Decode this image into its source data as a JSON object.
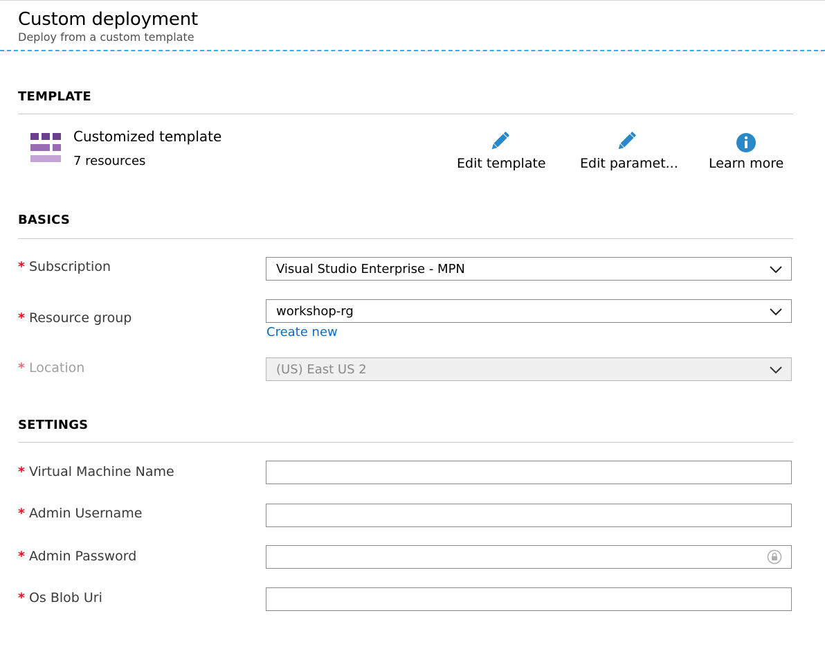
{
  "header": {
    "title": "Custom deployment",
    "subtitle": "Deploy from a custom template"
  },
  "colors": {
    "accent": "#2fb0e6",
    "link": "#0e6cc7",
    "required": "#e81123",
    "icon_blue": "#2a88c9",
    "template_purple": "#7a4a96"
  },
  "template_section": {
    "title": "TEMPLATE",
    "template_name": "Customized template",
    "resource_count": "7 resources",
    "icon": "template-grid-icon",
    "actions": [
      {
        "label": "Edit template",
        "icon": "pencil-icon"
      },
      {
        "label": "Edit paramet...",
        "icon": "pencil-icon"
      },
      {
        "label": "Learn more",
        "icon": "info-icon"
      }
    ]
  },
  "basics_section": {
    "title": "BASICS",
    "required_marker": "*",
    "subscription": {
      "label": "Subscription",
      "value": "Visual Studio Enterprise - MPN"
    },
    "resource_group": {
      "label": "Resource group",
      "value": "workshop-rg",
      "create_new": "Create new"
    },
    "location": {
      "label": "Location",
      "value": "(US) East US 2"
    }
  },
  "settings_section": {
    "title": "SETTINGS",
    "vm_name": {
      "label": "Virtual Machine Name",
      "value": ""
    },
    "admin_username": {
      "label": "Admin Username",
      "value": ""
    },
    "admin_password": {
      "label": "Admin Password",
      "value": ""
    },
    "os_blob_uri": {
      "label": "Os Blob Uri",
      "value": ""
    }
  }
}
